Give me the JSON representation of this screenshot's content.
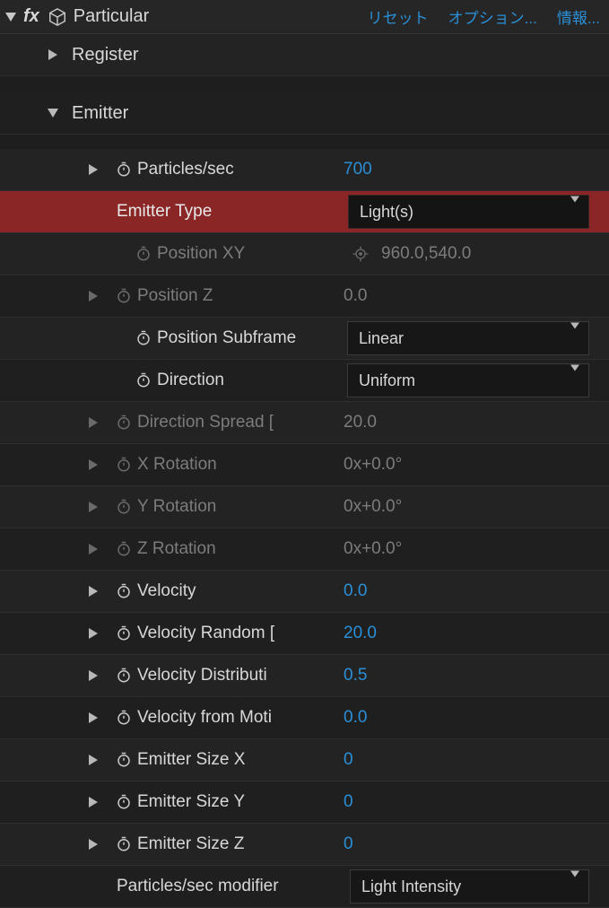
{
  "header": {
    "plugin": "Particular",
    "reset": "リセット",
    "options": "オプション...",
    "info": "情報..."
  },
  "groups": {
    "register": "Register",
    "emitter": "Emitter"
  },
  "props": {
    "particles_sec": {
      "label": "Particles/sec",
      "value": "700"
    },
    "emitter_type": {
      "label": "Emitter Type",
      "value": "Light(s)"
    },
    "position_xy": {
      "label": "Position XY",
      "value": "960.0,540.0"
    },
    "position_z": {
      "label": "Position Z",
      "value": "0.0"
    },
    "position_subframe": {
      "label": "Position Subframe",
      "value": "Linear"
    },
    "direction": {
      "label": "Direction",
      "value": "Uniform"
    },
    "direction_spread": {
      "label": "Direction Spread [",
      "value": "20.0"
    },
    "x_rotation": {
      "label": "X Rotation",
      "value": "0x+0.0°"
    },
    "y_rotation": {
      "label": "Y Rotation",
      "value": "0x+0.0°"
    },
    "z_rotation": {
      "label": "Z Rotation",
      "value": "0x+0.0°"
    },
    "velocity": {
      "label": "Velocity",
      "value": "0.0"
    },
    "velocity_random": {
      "label": "Velocity Random [",
      "value": "20.0"
    },
    "velocity_distribution": {
      "label": "Velocity Distributi",
      "value": "0.5"
    },
    "velocity_from_motion": {
      "label": "Velocity from Moti",
      "value": "0.0"
    },
    "emitter_size_x": {
      "label": "Emitter Size X",
      "value": "0"
    },
    "emitter_size_y": {
      "label": "Emitter Size Y",
      "value": "0"
    },
    "emitter_size_z": {
      "label": "Emitter Size Z",
      "value": "0"
    },
    "psm": {
      "label": "Particles/sec modifier",
      "value": "Light Intensity"
    }
  }
}
